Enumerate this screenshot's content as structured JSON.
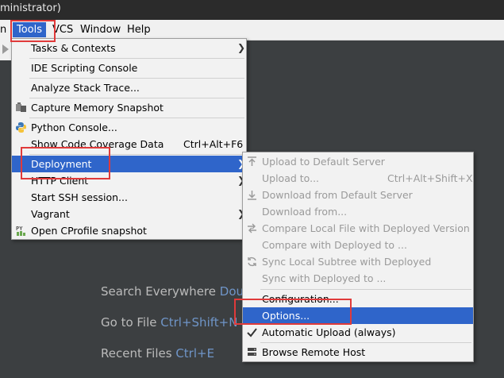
{
  "window": {
    "title_fragment": "ministrator)"
  },
  "menubar": {
    "items": [
      {
        "label": "n"
      },
      {
        "label": "Tools"
      },
      {
        "label": "VCS"
      },
      {
        "label": "Window"
      },
      {
        "label": "Help"
      }
    ]
  },
  "tools_menu": {
    "items": [
      {
        "label": "Tasks & Contexts"
      },
      {
        "label": "IDE Scripting Console"
      },
      {
        "label": "Analyze Stack Trace..."
      },
      {
        "label": "Capture Memory Snapshot"
      },
      {
        "label": "Python Console..."
      },
      {
        "label": "Show Code Coverage Data",
        "shortcut": "Ctrl+Alt+F6"
      },
      {
        "label": "Deployment"
      },
      {
        "label": "HTTP Client"
      },
      {
        "label": "Start SSH session..."
      },
      {
        "label": "Vagrant"
      },
      {
        "label": "Open CProfile snapshot"
      }
    ]
  },
  "deployment_menu": {
    "items": [
      {
        "label": "Upload to Default Server"
      },
      {
        "label": "Upload to...",
        "shortcut": "Ctrl+Alt+Shift+X"
      },
      {
        "label": "Download from Default Server"
      },
      {
        "label": "Download from..."
      },
      {
        "label": "Compare Local File with Deployed Version"
      },
      {
        "label": "Compare with Deployed to ..."
      },
      {
        "label": "Sync Local Subtree with Deployed"
      },
      {
        "label": "Sync with Deployed to ..."
      },
      {
        "label": "Configuration..."
      },
      {
        "label": "Options..."
      },
      {
        "label": "Automatic Upload (always)"
      },
      {
        "label": "Browse Remote Host"
      }
    ]
  },
  "welcome": {
    "search": {
      "label": "Search Everywhere",
      "shortcut": "Dou"
    },
    "goto": {
      "label": "Go to File",
      "shortcut": "Ctrl+Shift+N"
    },
    "recent": {
      "label": "Recent Files",
      "shortcut": "Ctrl+E"
    }
  },
  "colors": {
    "accent": "#2f65ca",
    "highlight_box": "#e03a3a",
    "menu_bg": "#f2f2f2",
    "editor_bg": "#3c3f41"
  }
}
